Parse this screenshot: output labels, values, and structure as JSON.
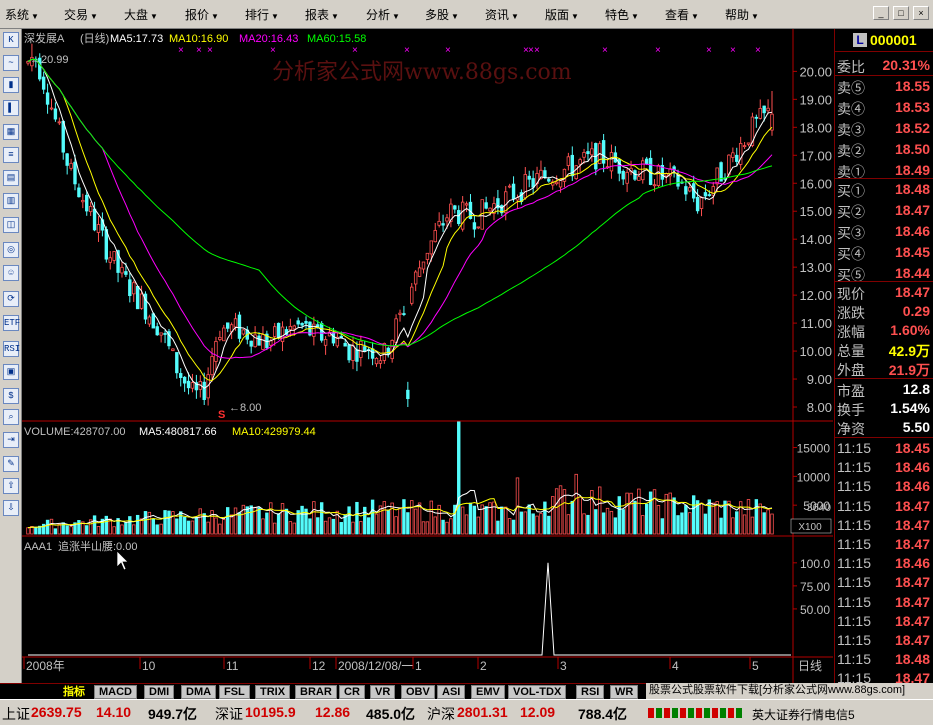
{
  "menu": [
    {
      "label": "系统",
      "arrow": "▼"
    },
    {
      "label": "交易",
      "arrow": "▼"
    },
    {
      "label": "大盘",
      "arrow": "▼"
    },
    {
      "label": "报价",
      "arrow": "▼"
    },
    {
      "label": "排行",
      "arrow": "▼"
    },
    {
      "label": "报表",
      "arrow": "▼"
    },
    {
      "label": "分析",
      "arrow": "▼"
    },
    {
      "label": "多股",
      "arrow": "▼"
    },
    {
      "label": "资讯",
      "arrow": "▼"
    },
    {
      "label": "版面",
      "arrow": "▼"
    },
    {
      "label": "特色",
      "arrow": "▼"
    },
    {
      "label": "查看",
      "arrow": "▼"
    },
    {
      "label": "帮助",
      "arrow": "▼"
    }
  ],
  "window_controls": {
    "min": "_",
    "max": "□",
    "close": "×"
  },
  "toolbar_icons": [
    "K-icon",
    "line-chart-icon",
    "candlestick-icon",
    "bar-chart-icon",
    "table-icon",
    "list-icon",
    "grid-icon",
    "multi-grid-icon",
    "quote-icon",
    "globe-icon",
    "person-icon",
    "refresh-icon",
    "etf-icon",
    "wave-icon",
    "rsi-icon",
    "calendar-icon",
    "dollar-icon",
    "magnify-icon",
    "export-icon",
    "pencil-icon",
    "arrow-up-icon",
    "arrow-down-icon"
  ],
  "toolbar_glyphs": [
    "K",
    "~",
    "▮",
    "▌",
    "▦",
    "≡",
    "▤",
    "▥",
    "◫",
    "◎",
    "☺",
    "⟳",
    "ETF",
    "≈",
    "RSI",
    "▣",
    "$",
    "⌕",
    "⇥",
    "✎",
    "⇧",
    "⇩"
  ],
  "main_chart": {
    "stock": "深发展A",
    "period": "(日线)",
    "ma5": "MA5:17.73",
    "ma10": "MA10:16.90",
    "ma20": "MA20:16.43",
    "ma60": "MA60:15.58",
    "watermark": "分析家公式网www.88gs.com",
    "high_label": "20.99",
    "low_label": "8.00",
    "low_arrow": "←",
    "s_marker": "S",
    "y_ticks": [
      "20.00",
      "19.00",
      "18.00",
      "17.00",
      "16.00",
      "15.00",
      "14.00",
      "13.00",
      "12.00",
      "11.00",
      "10.00",
      "9.00",
      "8.00"
    ],
    "x_labels": [
      "2008年",
      "10",
      "11",
      "12",
      "2008/12/08/一",
      "1",
      "2",
      "3",
      "4",
      "5"
    ],
    "period_label": "日线",
    "marker_glyph": "×",
    "colors": {
      "up": "#ff5050",
      "down": "#54fcfc",
      "ma5": "#ffffff",
      "ma10": "#ffff00",
      "ma20": "#ff00ff",
      "ma60": "#00ff00",
      "axis": "#b40000",
      "text": "#c0c0c0"
    }
  },
  "chart_data": [
    {
      "type": "candlestick",
      "title": "深发展A (日线)",
      "y_range": [
        7.5,
        20.8
      ],
      "start": 14.35,
      "end": 18.47,
      "high": 20.99,
      "low": 8.0,
      "series": [
        {
          "name": "MA5",
          "last": 17.73
        },
        {
          "name": "MA10",
          "last": 16.9
        },
        {
          "name": "MA20",
          "last": 16.43
        },
        {
          "name": "MA60",
          "last": 15.58
        }
      ]
    },
    {
      "type": "bar",
      "title": "VOLUME",
      "series": [
        {
          "name": "MA5",
          "last": 480817.66
        },
        {
          "name": "MA10",
          "last": 429979.44
        }
      ],
      "last": 428707.0,
      "y_ticks": [
        5000,
        10000,
        15000
      ],
      "unit": "X100",
      "current": 3640
    },
    {
      "type": "line",
      "title": "AAA1 追涨半山腰",
      "last": 0.0,
      "y_ticks": [
        50.0,
        75.0,
        100.0
      ],
      "spike_value": 100.0
    }
  ],
  "volume": {
    "label": "VOLUME:428707.00",
    "ma5": "MA5:480817.66",
    "ma10": "MA10:429979.44",
    "y_ticks": [
      "15000",
      "10000",
      "5000"
    ],
    "current": "3640",
    "unit": "X100"
  },
  "indicator": {
    "label": "AAA1",
    "name": "追涨半山腰:0.00",
    "y_ticks": [
      "100.0",
      "75.00",
      "50.00"
    ]
  },
  "side": {
    "code": "000001",
    "code_badge": "L",
    "weibi_label": "委比",
    "weibi": "20.31%",
    "sells": [
      {
        "l": "卖⑤",
        "v": "18.55"
      },
      {
        "l": "卖④",
        "v": "18.53"
      },
      {
        "l": "卖③",
        "v": "18.52"
      },
      {
        "l": "卖②",
        "v": "18.50"
      },
      {
        "l": "卖①",
        "v": "18.49"
      }
    ],
    "buys": [
      {
        "l": "买①",
        "v": "18.48"
      },
      {
        "l": "买②",
        "v": "18.47"
      },
      {
        "l": "买③",
        "v": "18.46"
      },
      {
        "l": "买④",
        "v": "18.45"
      },
      {
        "l": "买⑤",
        "v": "18.44"
      }
    ],
    "stats": [
      {
        "l": "现价",
        "v": "18.47"
      },
      {
        "l": "涨跌",
        "v": "0.29"
      },
      {
        "l": "涨幅",
        "v": "1.60%"
      },
      {
        "l": "总量",
        "v": "42.9万"
      },
      {
        "l": "外盘",
        "v": "21.9万"
      }
    ],
    "stats2": [
      {
        "l": "市盈",
        "v": "12.8"
      },
      {
        "l": "换手",
        "v": "1.54%"
      },
      {
        "l": "净资",
        "v": "5.50"
      }
    ],
    "ticks": [
      {
        "t": "11:15",
        "p": "18.45"
      },
      {
        "t": "11:15",
        "p": "18.46"
      },
      {
        "t": "11:15",
        "p": "18.46"
      },
      {
        "t": "11:15",
        "p": "18.47"
      },
      {
        "t": "11:15",
        "p": "18.47"
      },
      {
        "t": "11:15",
        "p": "18.47"
      },
      {
        "t": "11:15",
        "p": "18.46"
      },
      {
        "t": "11:15",
        "p": "18.47"
      },
      {
        "t": "11:15",
        "p": "18.47"
      },
      {
        "t": "11:15",
        "p": "18.47"
      },
      {
        "t": "11:15",
        "p": "18.47"
      },
      {
        "t": "11:15",
        "p": "18.48"
      },
      {
        "t": "11:15",
        "p": "18.47"
      }
    ]
  },
  "tabs": [
    "指标",
    "MACD",
    "DMI",
    "DMA",
    "FSL",
    "TRIX",
    "BRAR",
    "CR",
    "VR",
    "OBV",
    "ASI",
    "EMV",
    "VOL-TDX",
    "RSI",
    "WR"
  ],
  "ad_text": "股票公式股票软件下载[分析家公式网www.88gs.com]",
  "status": {
    "sh_label": "上证",
    "sh": "2639.75",
    "sh_chg": "14.10",
    "sh_vol": "949.7亿",
    "sz_label": "深证",
    "sz": "10195.9",
    "sz_chg": "12.86",
    "sz_vol": "485.0亿",
    "hs_label": "沪深",
    "hs": "2801.31",
    "hs_chg": "12.09",
    "hs_vol": "788.4亿",
    "broker": "英大证券行情电信5"
  }
}
